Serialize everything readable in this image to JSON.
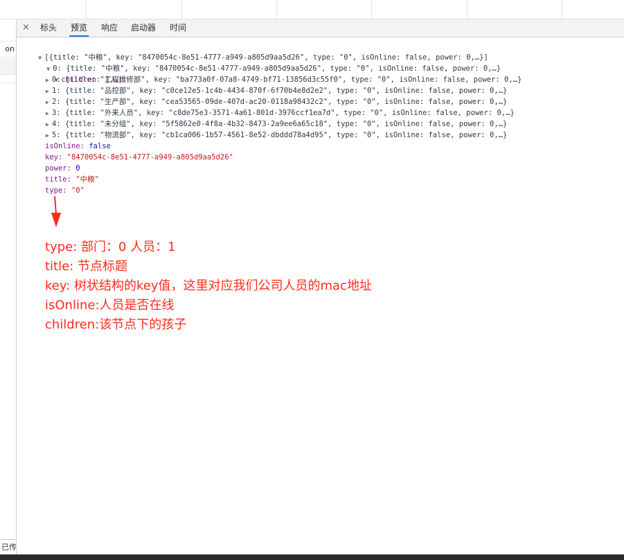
{
  "tabs": {
    "close_label": "×",
    "items": [
      {
        "label": "标头",
        "active": false
      },
      {
        "label": "预览",
        "active": true
      },
      {
        "label": "响应",
        "active": false
      },
      {
        "label": "启动器",
        "active": false
      },
      {
        "label": "时间",
        "active": false
      }
    ]
  },
  "left_panel": {
    "row_fragment": "on",
    "status_fragment": "已传"
  },
  "preview": {
    "root_summary": "[{title: \"中粮\", key: \"8470054c-8e51-4777-a949-a805d9aa5d26\", type: \"0\", isOnline: false, power: 0,…}]",
    "item0_summary": "0: {title: \"中粮\", key: \"8470054c-8e51-4777-a949-a805d9aa5d26\", type: \"0\", isOnline: false, power: 0,…}",
    "children_label": "children: [,…]",
    "children": [
      "0: {title: \"工程维修部\", key: \"ba773a0f-07a8-4749-bf71-13856d3c55f0\", type: \"0\", isOnline: false, power: 0,…}",
      "1: {title: \"品控部\", key: \"c0ce12e5-1c4b-4434-870f-6f70b4e8d2e2\", type: \"0\", isOnline: false, power: 0,…}",
      "2: {title: \"生产部\", key: \"cea53565-09de-407d-ac20-0118a98432c2\", type: \"0\", isOnline: false, power: 0,…}",
      "3: {title: \"外来人员\", key: \"c8de75e3-3571-4a61-801d-3976ccf1ea7d\", type: \"0\", isOnline: false, power: 0,…}",
      "4: {title: \"未分组\", key: \"5f5862e0-4f8a-4b32-8473-2a9ee6a65c18\", type: \"0\", isOnline: false, power: 0,…}",
      "5: {title: \"物流部\", key: \"cb1ca006-1b57-4561-8e52-dbddd78a4d95\", type: \"0\", isOnline: false, power: 0,…}"
    ],
    "props": {
      "isOnline_key": "isOnline:",
      "isOnline_val": "false",
      "key_key": "key:",
      "key_val": "\"8470054c-8e51-4777-a949-a805d9aa5d26\"",
      "power_key": "power:",
      "power_val": "0",
      "title_key": "title:",
      "title_val": "\"中粮\"",
      "type_key": "type:",
      "type_val": "\"0\""
    }
  },
  "annotation": {
    "lines": [
      "type: 部门：0  人员：1",
      "title: 节点标题",
      "key: 树状结构的key值，这里对应我们公司人员的mac地址",
      "isOnline:人员是否在线",
      "children:该节点下的孩子"
    ],
    "color": "#ff2a1a"
  },
  "colors": {
    "accent": "#1a73e8",
    "key": "#881391",
    "string": "#c41a16",
    "number": "#1c00cf",
    "keyword": "#0d22aa"
  }
}
